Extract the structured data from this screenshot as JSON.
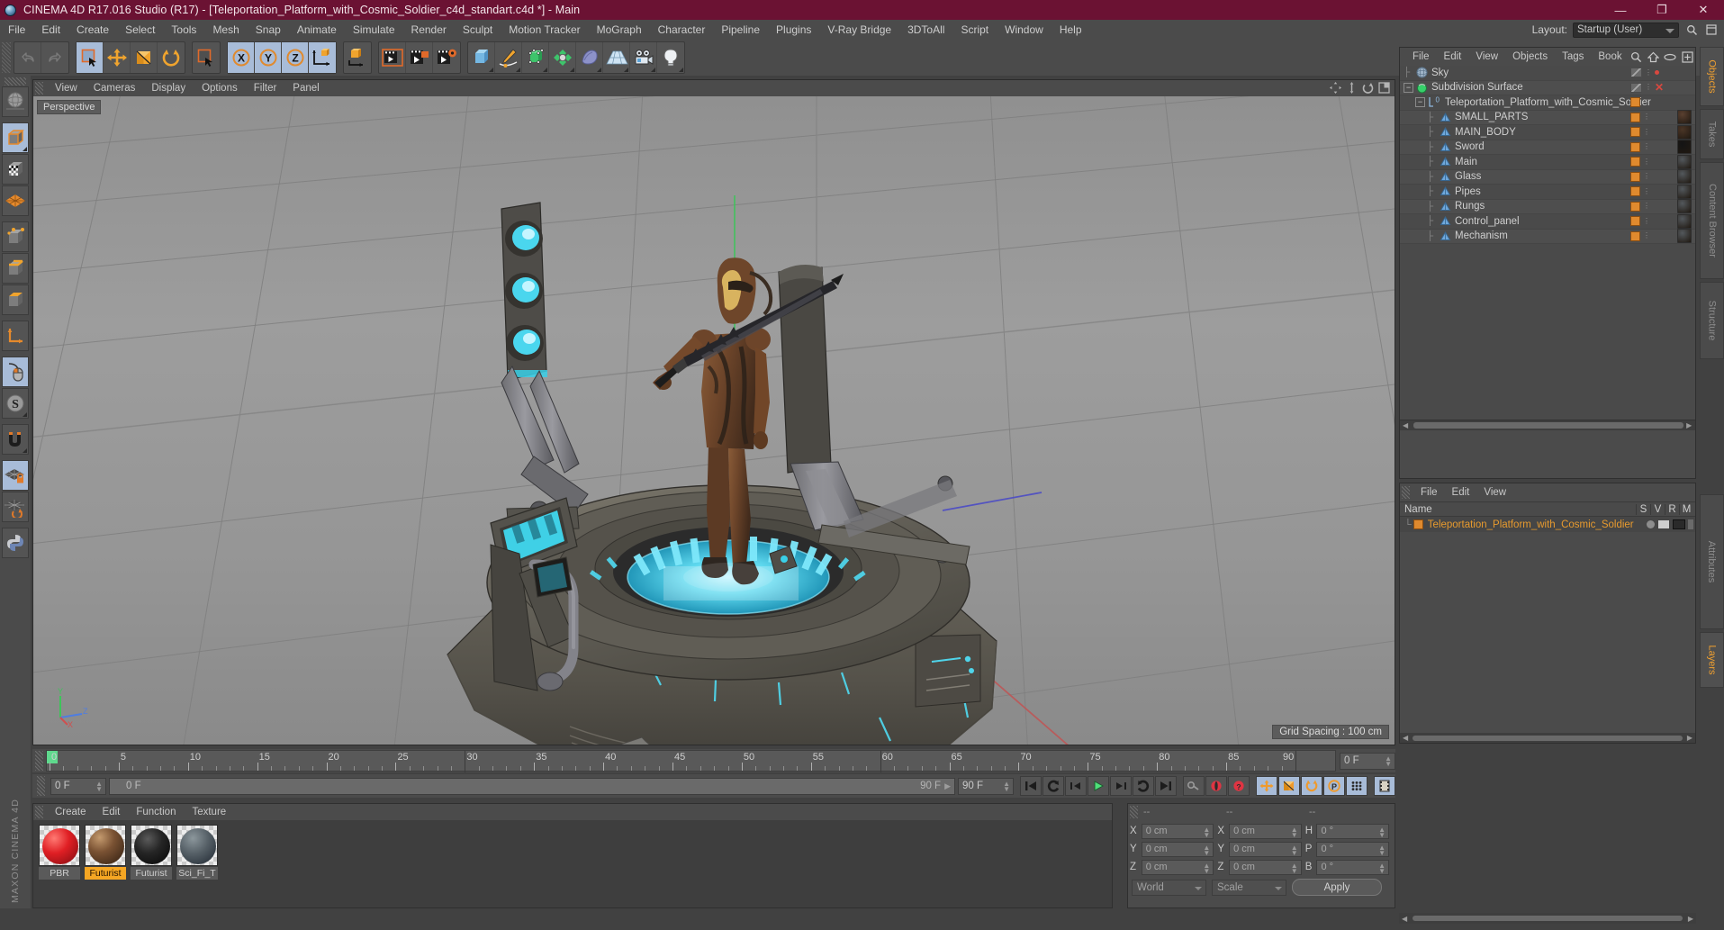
{
  "window": {
    "title": "CINEMA 4D R17.016 Studio (R17) - [Teleportation_Platform_with_Cosmic_Soldier_c4d_standart.c4d *] - Main",
    "app_icon": "cinema4d-orb-icon",
    "minimize": "—",
    "restore": "❐",
    "close": "✕",
    "titlebar_color": "#6b1233"
  },
  "menubar": {
    "items": [
      "File",
      "Edit",
      "Create",
      "Select",
      "Tools",
      "Mesh",
      "Snap",
      "Animate",
      "Simulate",
      "Render",
      "Sculpt",
      "Motion Tracker",
      "MoGraph",
      "Character",
      "Pipeline",
      "Plugins",
      "V-Ray Bridge",
      "3DToAll",
      "Script",
      "Window",
      "Help"
    ],
    "layout_label": "Layout:",
    "layout_value": "Startup (User)",
    "search_icon": "search-icon",
    "window_icon": "window-icon"
  },
  "toolbar": {
    "groups": [
      {
        "name": "history",
        "buttons": [
          {
            "name": "undo-button",
            "icon": "undo-icon",
            "active": false
          },
          {
            "name": "redo-button",
            "icon": "redo-icon",
            "active": false
          }
        ]
      },
      {
        "name": "transform",
        "buttons": [
          {
            "name": "live-selection-button",
            "icon": "selection-cursor-icon",
            "active": true
          },
          {
            "name": "move-button",
            "icon": "move-arrows-icon",
            "active": false
          },
          {
            "name": "scale-button",
            "icon": "scale-box-icon",
            "active": false
          },
          {
            "name": "rotate-button",
            "icon": "rotate-circle-icon",
            "active": false
          }
        ]
      },
      {
        "name": "selection-mode",
        "buttons": [
          {
            "name": "select-tool-button",
            "icon": "selection-cursor-icon",
            "active": false
          }
        ]
      },
      {
        "name": "axis-lock",
        "buttons": [
          {
            "name": "x-axis-button",
            "icon": "x-axis-icon",
            "active": true
          },
          {
            "name": "y-axis-button",
            "icon": "y-axis-icon",
            "active": true
          },
          {
            "name": "z-axis-button",
            "icon": "z-axis-icon",
            "active": true
          },
          {
            "name": "world-coordinates-button",
            "icon": "world-axis-cube-icon",
            "active": false
          }
        ]
      },
      {
        "name": "object-axis",
        "buttons": [
          {
            "name": "object-axis-button",
            "icon": "object-axis-cube-icon",
            "active": false
          }
        ]
      },
      {
        "name": "render",
        "buttons": [
          {
            "name": "render-view-button",
            "icon": "render-clapper-icon",
            "active": false
          },
          {
            "name": "render-to-picture-button",
            "icon": "render-picture-icon",
            "active": false
          },
          {
            "name": "render-settings-button",
            "icon": "render-settings-gear-icon",
            "active": false
          }
        ]
      },
      {
        "name": "create",
        "buttons": [
          {
            "name": "add-cube-button",
            "icon": "cube-icon",
            "active": false
          },
          {
            "name": "add-spline-button",
            "icon": "pen-spline-icon",
            "active": false
          },
          {
            "name": "add-generator-button",
            "icon": "green-cube-generator-icon",
            "active": false
          },
          {
            "name": "add-deformer-button",
            "icon": "green-deformer-icon",
            "active": false
          },
          {
            "name": "add-scene-object-button",
            "icon": "bend-surface-icon",
            "active": false
          },
          {
            "name": "add-floor-button",
            "icon": "floor-grid-icon",
            "active": false
          },
          {
            "name": "add-camera-button",
            "icon": "camera-icon",
            "active": false
          },
          {
            "name": "add-light-button",
            "icon": "light-bulb-icon",
            "active": false
          }
        ]
      }
    ]
  },
  "left_palette": {
    "buttons": [
      {
        "name": "texture-axis-tool",
        "icon": "globe-sphere-icon",
        "active": false
      },
      {
        "name": "model-mode-button",
        "icon": "grey-cube-icon",
        "active": true
      },
      {
        "name": "texture-mode-button",
        "icon": "checker-cube-icon",
        "active": false
      },
      {
        "name": "points-mode-button",
        "icon": "points-mesh-icon",
        "active": false
      },
      {
        "name": "edges-mode-button",
        "icon": "edges-mesh-icon",
        "active": false
      },
      {
        "name": "polygons-mode-button",
        "icon": "polygons-mesh-icon",
        "active": false
      },
      {
        "name": "object-axis-mode-button",
        "icon": "orange-axis-icon",
        "active": false
      },
      {
        "name": "viewport-solo-button",
        "icon": "mouse-icon",
        "active": true
      },
      {
        "name": "enable-axis-button",
        "icon": "s-circle-icon",
        "active": false
      },
      {
        "name": "enable-snap-button",
        "icon": "magnet-icon",
        "active": false
      },
      {
        "name": "lock-workplane-button",
        "icon": "locked-grid-icon",
        "active": true
      },
      {
        "name": "workplane-button",
        "icon": "grid-rotate-icon",
        "active": false
      },
      {
        "name": "python-button",
        "icon": "python-icon",
        "active": false
      }
    ],
    "brand": "MAXON CINEMA 4D"
  },
  "viewport": {
    "menu": [
      "View",
      "Cameras",
      "Display",
      "Options",
      "Filter",
      "Panel"
    ],
    "label": "Perspective",
    "grid_spacing": "Grid Spacing : 100 cm",
    "nav_icons": [
      "pan-icon",
      "dolly-icon",
      "orbit-icon",
      "maximize-icon"
    ],
    "axis_labels": {
      "y": "Y",
      "x": "X",
      "z": "Z"
    }
  },
  "timeline": {
    "start_frame_field": "0 F",
    "marks": [
      {
        "label": "0",
        "frame": 0
      },
      {
        "label": "5",
        "frame": 5
      },
      {
        "label": "10",
        "frame": 10
      },
      {
        "label": "15",
        "frame": 15
      },
      {
        "label": "20",
        "frame": 20
      },
      {
        "label": "25",
        "frame": 25
      },
      {
        "label": "30",
        "frame": 30
      },
      {
        "label": "35",
        "frame": 35
      },
      {
        "label": "40",
        "frame": 40
      },
      {
        "label": "45",
        "frame": 45
      },
      {
        "label": "50",
        "frame": 50
      },
      {
        "label": "55",
        "frame": 55
      },
      {
        "label": "60",
        "frame": 60
      },
      {
        "label": "65",
        "frame": 65
      },
      {
        "label": "70",
        "frame": 70
      },
      {
        "label": "75",
        "frame": 75
      },
      {
        "label": "80",
        "frame": 80
      },
      {
        "label": "85",
        "frame": 85
      },
      {
        "label": "90",
        "frame": 90
      }
    ],
    "range_min": 0,
    "range_max": 90,
    "current_frame": 0
  },
  "transport": {
    "current_frame_field": "0 F",
    "preview_min_field": "0 F",
    "preview_max_field": "90 F",
    "end_frame_field": "90 F",
    "buttons": [
      {
        "name": "go-to-start-button",
        "icon": "skip-start-icon",
        "active": false
      },
      {
        "name": "play-reverse-loop-button",
        "icon": "loop-reverse-icon",
        "active": false
      },
      {
        "name": "step-back-button",
        "icon": "step-back-icon",
        "active": false
      },
      {
        "name": "play-button",
        "icon": "play-icon",
        "active": false
      },
      {
        "name": "step-forward-button",
        "icon": "step-forward-icon",
        "active": false
      },
      {
        "name": "play-forward-loop-button",
        "icon": "loop-forward-icon",
        "active": false
      },
      {
        "name": "go-to-end-button",
        "icon": "skip-end-icon",
        "active": false
      }
    ],
    "record_buttons": [
      {
        "name": "autokey-button",
        "icon": "key-icon",
        "active": false
      },
      {
        "name": "record-active-objects-button",
        "icon": "record-circle-icon",
        "active": false
      },
      {
        "name": "autokeying-button",
        "icon": "question-circle-icon",
        "active": false
      }
    ],
    "keyframe_buttons": [
      {
        "name": "record-position-button",
        "icon": "move-cross-icon",
        "active": true
      },
      {
        "name": "record-scale-button",
        "icon": "scale-icon",
        "active": true
      },
      {
        "name": "record-rotation-button",
        "icon": "rotate-icon",
        "active": true
      },
      {
        "name": "record-param-button",
        "icon": "p-circle-icon",
        "active": true
      },
      {
        "name": "record-pla-button",
        "icon": "point-level-icon",
        "active": true
      }
    ],
    "extra_button": {
      "name": "timeline-toggle-button",
      "icon": "film-strip-icon",
      "active": true
    }
  },
  "material_manager": {
    "menu": [
      "Create",
      "Edit",
      "Function",
      "Texture"
    ],
    "materials": [
      {
        "name": "PBR",
        "color": "#d81f22",
        "selected": false
      },
      {
        "name": "Futurist",
        "color": "#6b4a33",
        "selected": true
      },
      {
        "name": "Futurist",
        "color": "#181818",
        "selected": false
      },
      {
        "name": "Sci_Fi_T",
        "color": "#5a6268",
        "selected": false
      }
    ]
  },
  "coordinates": {
    "headers": [
      "--",
      "--",
      "--"
    ],
    "rows": [
      {
        "pos_label": "X",
        "pos_value": "0 cm",
        "size_label": "X",
        "size_value": "0 cm",
        "rot_label": "H",
        "rot_value": "0 °"
      },
      {
        "pos_label": "Y",
        "pos_value": "0 cm",
        "size_label": "Y",
        "size_value": "0 cm",
        "rot_label": "P",
        "rot_value": "0 °"
      },
      {
        "pos_label": "Z",
        "pos_value": "0 cm",
        "size_label": "Z",
        "size_value": "0 cm",
        "rot_label": "B",
        "rot_value": "0 °"
      }
    ],
    "system_select": "World",
    "mode_select": "Scale",
    "apply_button": "Apply"
  },
  "object_manager": {
    "menu": [
      "File",
      "Edit",
      "View",
      "Objects",
      "Tags",
      "Book"
    ],
    "icons": [
      "search-icon",
      "home-icon",
      "eye-icon",
      "plus-icon"
    ],
    "rows": [
      {
        "name": "Sky",
        "icon": "sky-sphere-icon",
        "indent": 1,
        "tag": "diag",
        "extra": "reddot",
        "thumb": null
      },
      {
        "name": "Subdivision Surface",
        "icon": "subdivision-green-icon",
        "indent": 1,
        "tag": "diag",
        "extra": "xmark",
        "thumb": null,
        "expander": "minus"
      },
      {
        "name": "Teleportation_Platform_with_Cosmic_Soldier",
        "icon": "null-object-icon",
        "indent": 2,
        "tag": "orange",
        "extra": "dots",
        "thumb": null,
        "expander": "minus"
      },
      {
        "name": "SMALL_PARTS",
        "icon": "polygon-object-icon",
        "indent": 3,
        "tag": "orange",
        "extra": "dots",
        "thumb": "#5a4030"
      },
      {
        "name": "MAIN_BODY",
        "icon": "polygon-object-icon",
        "indent": 3,
        "tag": "orange",
        "extra": "dots",
        "thumb": "#4a3526"
      },
      {
        "name": "Sword",
        "icon": "polygon-object-icon",
        "indent": 3,
        "tag": "orange",
        "extra": "dots",
        "thumb": "#141414"
      },
      {
        "name": "Main",
        "icon": "polygon-object-icon",
        "indent": 3,
        "tag": "orange",
        "extra": "dots",
        "thumb": "#53585c"
      },
      {
        "name": "Glass",
        "icon": "polygon-object-icon",
        "indent": 3,
        "tag": "orange",
        "extra": "dots",
        "thumb": "#53585c"
      },
      {
        "name": "Pipes",
        "icon": "polygon-object-icon",
        "indent": 3,
        "tag": "orange",
        "extra": "dots",
        "thumb": "#53585c"
      },
      {
        "name": "Rungs",
        "icon": "polygon-object-icon",
        "indent": 3,
        "tag": "orange",
        "extra": "dots",
        "thumb": "#53585c"
      },
      {
        "name": "Control_panel",
        "icon": "polygon-object-icon",
        "indent": 3,
        "tag": "orange",
        "extra": "dots",
        "thumb": "#53585c"
      },
      {
        "name": "Mechanism",
        "icon": "polygon-object-icon",
        "indent": 3,
        "tag": "orange",
        "extra": "dots",
        "thumb": "#53585c"
      }
    ]
  },
  "layer_manager": {
    "menu": [
      "File",
      "Edit",
      "View"
    ],
    "header_name": "Name",
    "header_cols": [
      "S",
      "V",
      "R",
      "M"
    ],
    "rows": [
      {
        "name": "Teleportation_Platform_with_Cosmic_Soldier",
        "color": "#e08a2e"
      }
    ]
  },
  "right_tabs": [
    {
      "label": "Objects",
      "active": true
    },
    {
      "label": "Takes",
      "active": false
    },
    {
      "label": "Content Browser",
      "active": false
    },
    {
      "label": "Structure",
      "active": false
    },
    {
      "label": "Attributes",
      "active": false
    },
    {
      "label": "Layers",
      "active": true
    }
  ],
  "scene": {
    "description": "3D viewport showing a sci-fi teleportation platform with a cosmic soldier holding a sword",
    "accent_glow": "#3fd8e8",
    "platform_body": "#4a4a44"
  }
}
